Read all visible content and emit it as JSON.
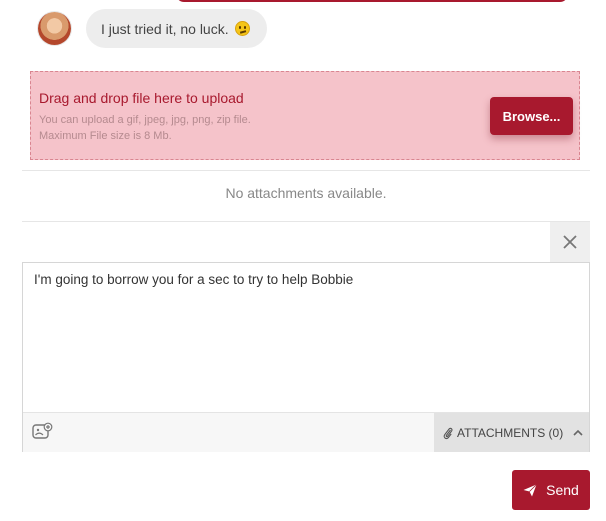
{
  "chat": {
    "message_text": "I just tried it, no luck.",
    "emoji": "confused-face-emoji"
  },
  "upload": {
    "title": "Drag and drop file here to upload",
    "allowed_types": "You can upload a gif, jpeg, jpg, png, zip file.",
    "max_size": "Maximum File size is 8 Mb.",
    "browse_label": "Browse..."
  },
  "attachments": {
    "empty_text": "No attachments available.",
    "footer_label": "ATTACHMENTS (0)"
  },
  "composer": {
    "text": "I'm going to borrow you for a sec to try to help Bobbie"
  },
  "send": {
    "label": "Send"
  },
  "icons": {
    "close": "close-icon",
    "emoji_picker": "emoji-picker-icon",
    "attachment": "paperclip-icon",
    "chevron": "chevron-up-icon",
    "send": "paper-plane-icon"
  },
  "colors": {
    "accent": "#a8192e",
    "dropzone_bg": "#f5c3ca",
    "bubble_bg": "#ededed"
  }
}
